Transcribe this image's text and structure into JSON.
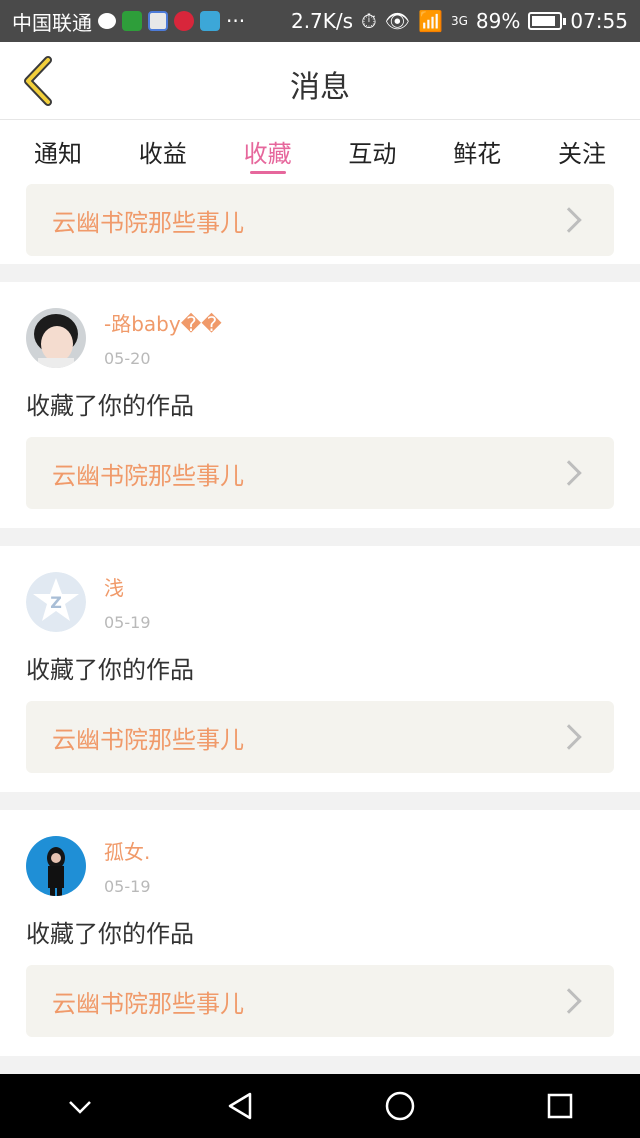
{
  "status_bar": {
    "carrier": "中国联通",
    "dots": "···",
    "speed": "2.7K/s",
    "signal": "3G",
    "battery": "89%",
    "battery_level": 0.89,
    "time": "07:55"
  },
  "header": {
    "title": "消息"
  },
  "tabs": [
    {
      "label": "通知"
    },
    {
      "label": "收益"
    },
    {
      "label": "收藏",
      "active": true
    },
    {
      "label": "互动"
    },
    {
      "label": "鲜花"
    },
    {
      "label": "关注"
    }
  ],
  "first_book": "云幽书院那些事儿",
  "cards": [
    {
      "user": "-路baby��",
      "date": "05-20",
      "action": "收藏了你的作品",
      "book": "云幽书院那些事儿"
    },
    {
      "user": "浅",
      "date": "05-19",
      "action": "收藏了你的作品",
      "book": "云幽书院那些事儿"
    },
    {
      "user": "孤女.",
      "date": "05-19",
      "action": "收藏了你的作品",
      "book": "云幽书院那些事儿"
    }
  ],
  "colors": {
    "accent": "#e6679c",
    "link": "#f09a6a",
    "book_bg": "#f4f3ee"
  }
}
